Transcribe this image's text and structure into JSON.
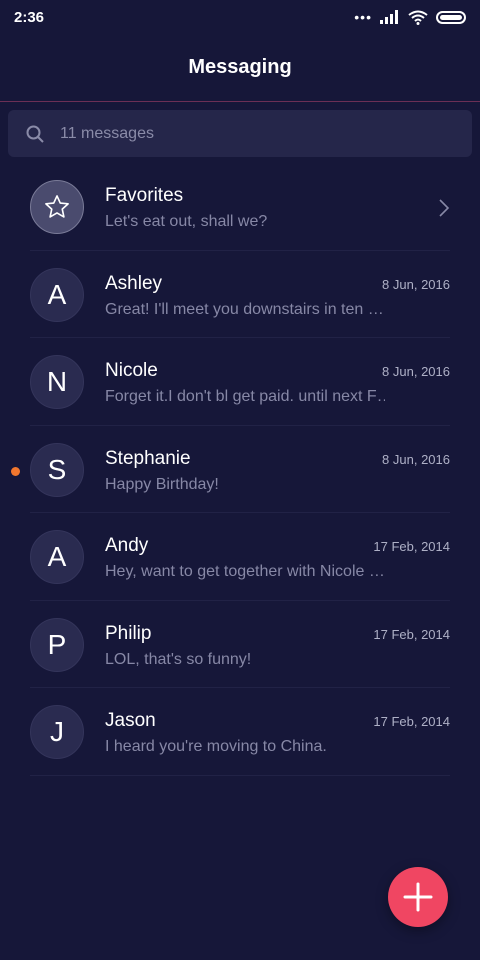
{
  "status_bar": {
    "time": "2:36",
    "dots": "•••"
  },
  "header": {
    "title": "Messaging"
  },
  "search": {
    "text": "11 messages",
    "icon": "search-icon"
  },
  "conversations": [
    {
      "initial": "",
      "name": "Favorites",
      "preview": "Let's eat out, shall we?",
      "date": "",
      "icon": "star-icon"
    },
    {
      "initial": "A",
      "name": "Ashley",
      "preview": "Great! I'll meet you downstairs in ten …",
      "date": "8 Jun, 2016"
    },
    {
      "initial": "N",
      "name": "Nicole",
      "preview": "Forget it.I don't bl get paid. until next F…",
      "date": "8 Jun, 2016"
    },
    {
      "initial": "S",
      "name": "Stephanie",
      "preview": "Happy Birthday!",
      "date": "8 Jun, 2016",
      "unread": true
    },
    {
      "initial": "A",
      "name": "Andy",
      "preview": "Hey, want to get together with Nicole …",
      "date": "17 Feb, 2014"
    },
    {
      "initial": "P",
      "name": "Philip",
      "preview": "LOL, that's so funny!",
      "date": "17 Feb, 2014"
    },
    {
      "initial": "J",
      "name": "Jason",
      "preview": "I heard you're moving to China.",
      "date": "17 Feb, 2014"
    }
  ],
  "colors": {
    "background": "#161739",
    "accent_fab": "#f04662",
    "unread_dot": "#f2772e",
    "divider": "#6b2f55"
  }
}
